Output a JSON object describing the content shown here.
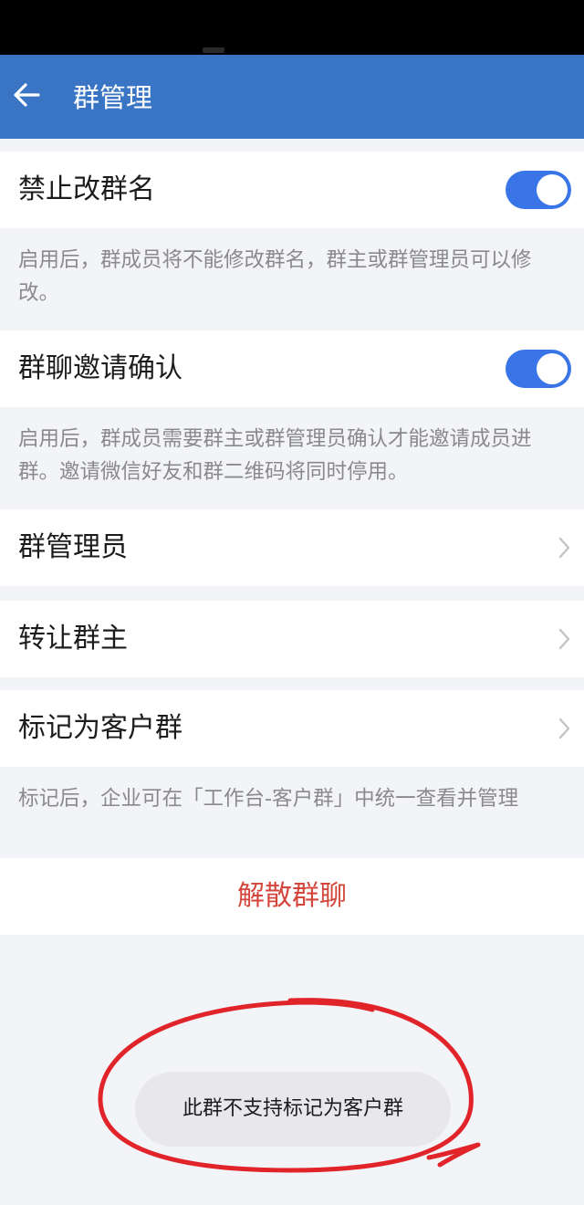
{
  "header": {
    "title": "群管理",
    "back_icon": "back-arrow-icon"
  },
  "settings": {
    "rename": {
      "label": "禁止改群名",
      "enabled": true,
      "description": "启用后，群成员将不能修改群名，群主或群管理员可以修改。"
    },
    "invite_confirm": {
      "label": "群聊邀请确认",
      "enabled": true,
      "description": "启用后，群成员需要群主或群管理员确认才能邀请成员进群。邀请微信好友和群二维码将同时停用。"
    },
    "admins": {
      "label": "群管理员"
    },
    "transfer_owner": {
      "label": "转让群主"
    },
    "mark_customer": {
      "label": "标记为客户群",
      "description": "标记后，企业可在「工作台-客户群」中统一查看并管理"
    },
    "dissolve": {
      "label": "解散群聊"
    }
  },
  "toast": {
    "message": "此群不支持标记为客户群"
  },
  "colors": {
    "app_bar": "#3a75c5",
    "toggle_on": "#3a75e8",
    "danger": "#d4463b",
    "annotation": "#e0242a",
    "background": "#f3f4f8"
  }
}
